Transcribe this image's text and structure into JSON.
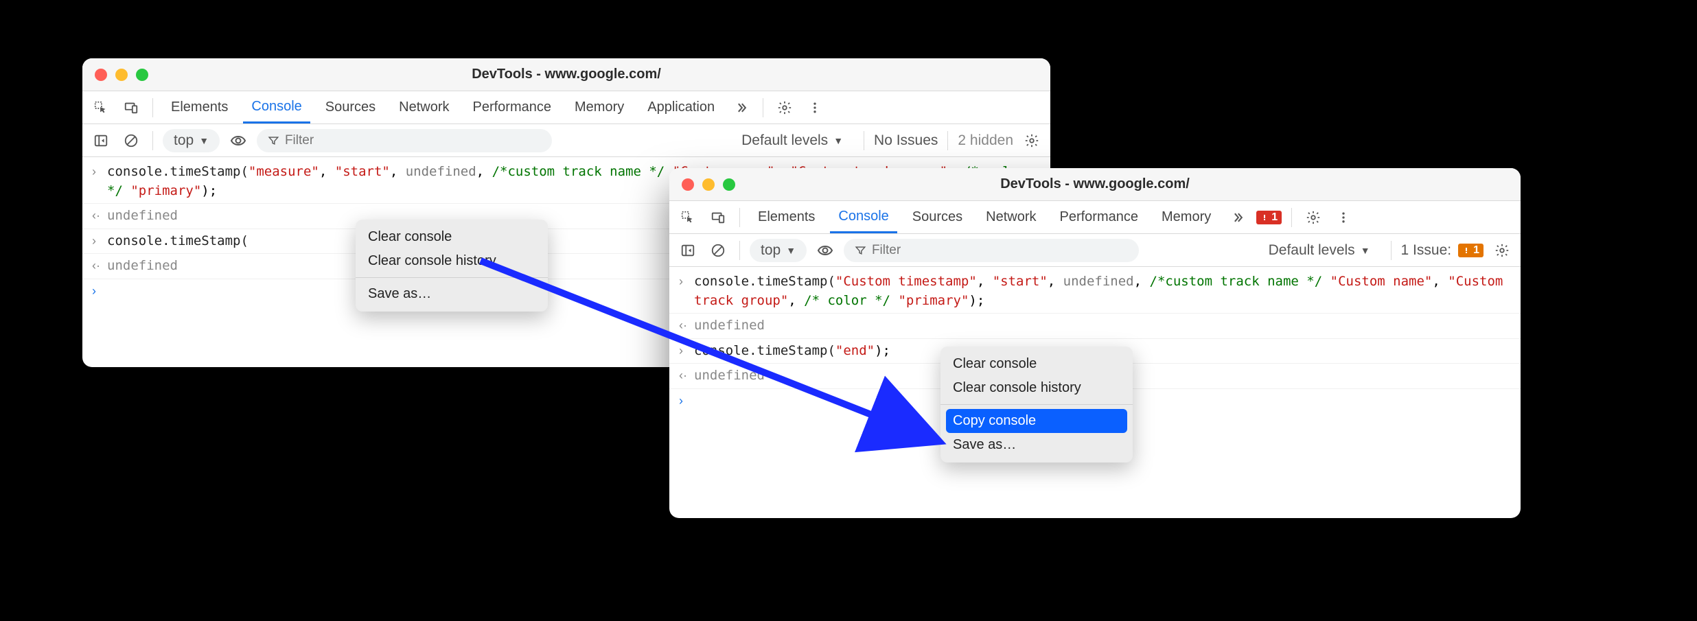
{
  "windowA": {
    "title": "DevTools - www.google.com/",
    "tabs": [
      "Elements",
      "Console",
      "Sources",
      "Network",
      "Performance",
      "Memory",
      "Application"
    ],
    "activeTab": "Console",
    "toolbar": {
      "context": "top",
      "filterPlaceholder": "Filter",
      "levels": "Default levels",
      "issues": "No Issues",
      "hidden": "2 hidden"
    },
    "console": {
      "line1_pre": "console.timeStamp(",
      "line1_s1": "\"measure\"",
      "line1_c1": ", ",
      "line1_s2": "\"start\"",
      "line1_c2": ", ",
      "line1_kw": "undefined",
      "line1_c3": ", ",
      "line1_cmt1": "/*custom track name */",
      "line1_nl": " ",
      "line1_s3": "\"Custom name\"",
      "line1_c4": ", ",
      "line1_s4": "\"Custom track group\"",
      "line1_c5": ", ",
      "line1_cmt2": "/* color */",
      "line1_sp": " ",
      "line1_s5": "\"primary\"",
      "line1_end": ");",
      "ret1": "undefined",
      "line2": "console.timeStamp(",
      "ret2": "undefined"
    },
    "menu": {
      "clear": "Clear console",
      "history": "Clear console history",
      "save": "Save as…"
    }
  },
  "windowB": {
    "title": "DevTools - www.google.com/",
    "tabs": [
      "Elements",
      "Console",
      "Sources",
      "Network",
      "Performance",
      "Memory"
    ],
    "activeTab": "Console",
    "errorBadge": "1",
    "toolbar": {
      "context": "top",
      "filterPlaceholder": "Filter",
      "levels": "Default levels",
      "issues": "1 Issue:",
      "issueBadge": "1"
    },
    "console": {
      "line1_pre": "console.timeStamp(",
      "line1_s1": "\"Custom timestamp\"",
      "line1_c1": ", ",
      "line1_s2": "\"start\"",
      "line1_c2": ", ",
      "line1_kw": "undefined",
      "line1_c3": ", ",
      "line1_cmt1": "/*custom track name */",
      "line1_nl": " ",
      "line1_s3": "\"Custom name\"",
      "line1_c4": ", ",
      "line1_s4": "\"Custom track group\"",
      "line1_c5": ", ",
      "line1_cmt2": "/* color */",
      "line1_sp": " ",
      "line1_s5": "\"primary\"",
      "line1_end": ");",
      "ret1": "undefined",
      "line2_pre": "console.timeStamp(",
      "line2_s1": "\"end\"",
      "line2_end": ");",
      "ret2": "undefined"
    },
    "menu": {
      "clear": "Clear console",
      "history": "Clear console history",
      "copy": "Copy console",
      "save": "Save as…"
    }
  }
}
